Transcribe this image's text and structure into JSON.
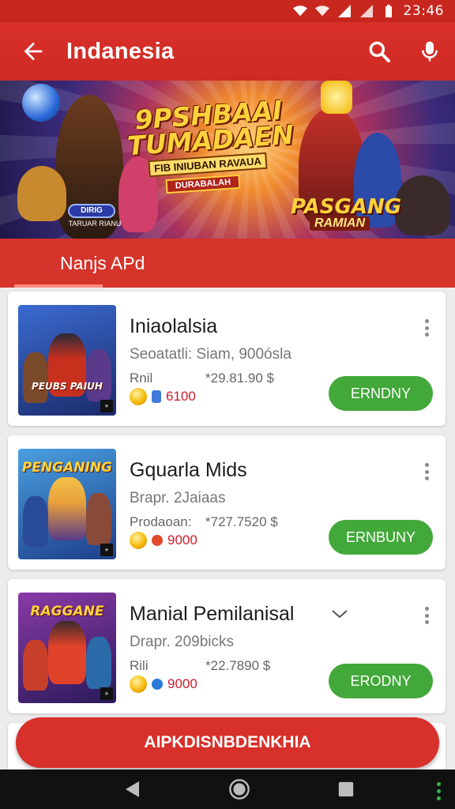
{
  "status_bar": {
    "time": "23:46",
    "icons": [
      "signal-icon",
      "wifi-icon",
      "signal-icon",
      "signal-icon",
      "battery-icon"
    ]
  },
  "app_bar": {
    "title": "Indanesia",
    "back_icon": "arrow-left-icon",
    "search_icon": "search-icon",
    "mic_icon": "microphone-icon"
  },
  "banner": {
    "headline": "9PSHBAAI TUMADAEN",
    "sub1": "FIB INIUBAN RAVAUA",
    "sub2": "DURABALAH",
    "pill_label": "DIRIG",
    "pill_caption": "TARUAR RIANU",
    "logo": "PASGANG",
    "logo_sub": "RAMIAN"
  },
  "tab": {
    "label": "Nanjs APd"
  },
  "apps": [
    {
      "thumb_title": "PEUBS PAIUH",
      "name": "Iniaolalsia",
      "meta": "Seoatatli: Siam, 900ósla",
      "line3_label": "Rnil",
      "line3_price": "*29.81.90 $",
      "rating": "6100",
      "button": "ERNDNY",
      "colors": {
        "bg": "#2b4aa8",
        "accent": "#c8301e"
      }
    },
    {
      "thumb_title": "PENGANING",
      "name": "Gquarla Mids",
      "meta": "Brapr. 2Jaiaas",
      "line3_label": "Prodaoan:",
      "line3_price": "*727.7520 $",
      "rating": "9000",
      "button": "ERNBUNY",
      "colors": {
        "bg": "#3576c9",
        "accent": "#f2b23a"
      }
    },
    {
      "thumb_title": "RAGGANE",
      "name": "Manial Pemilanisal",
      "meta": "Drapr. 209bicks",
      "line3_label": "Rili",
      "line3_price": "*22.7890 $",
      "rating": "9000",
      "button": "ERODNY",
      "colors": {
        "bg": "#5a2a80",
        "accent": "#e0432a"
      }
    }
  ],
  "cta": {
    "label": "AIPKDISNBDENKHIA"
  },
  "nav": {
    "back_icon": "triangle-back-icon",
    "home_icon": "circle-home-icon",
    "recents_icon": "square-recents-icon",
    "menu_icon": "more-vert-icon"
  },
  "theme": {
    "primary": "#d8302a",
    "install": "#43a83a"
  }
}
